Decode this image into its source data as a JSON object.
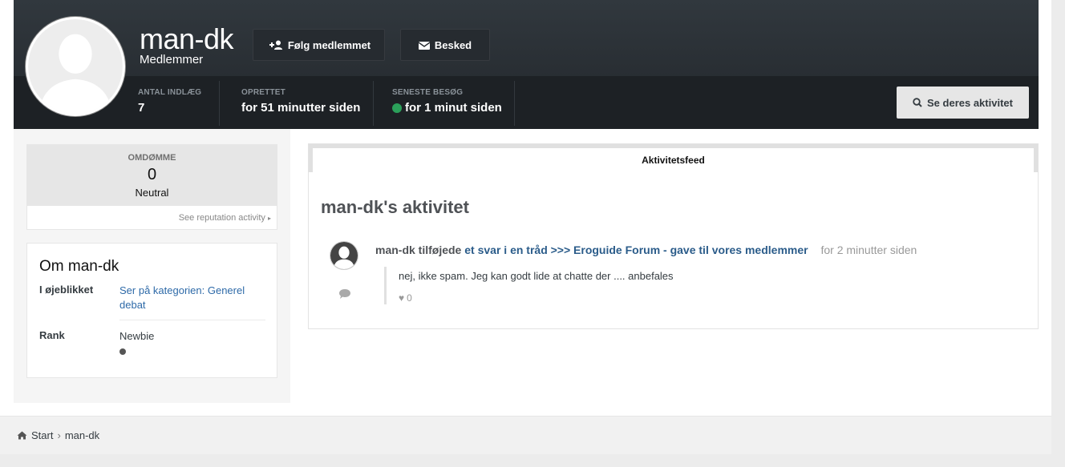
{
  "profile": {
    "username": "man-dk",
    "usergroup": "Medlemmer",
    "follow_button": "Følg medlemmet",
    "message_button": "Besked",
    "activity_button": "Se deres aktivitet",
    "stats": [
      {
        "label": "ANTAL INDLÆG",
        "value": "7"
      },
      {
        "label": "OPRETTET",
        "value": "for 51 minutter siden"
      },
      {
        "label": "SENESTE BESØG",
        "value": "for 1 minut siden",
        "online": true
      }
    ]
  },
  "sidebar": {
    "reputation": {
      "label": "OMDØMME",
      "value": "0",
      "word": "Neutral",
      "link": "See reputation activity"
    },
    "about": {
      "title": "Om man-dk",
      "rows": [
        {
          "key": "I øjeblikket",
          "value": "Ser på kategorien: Generel debat"
        },
        {
          "key": "Rank",
          "value": "Newbie"
        }
      ]
    }
  },
  "feed": {
    "tab": "Aktivitetsfeed",
    "title": "man-dk's aktivitet",
    "items": [
      {
        "who": "man-dk tilføjede",
        "what": "et svar i en tråd >>> Eroguide Forum - gave til vores medlemmer",
        "when": "for 2 minutter siden",
        "snippet": "nej, ikke spam. Jeg kan godt lide at chatte der .... anbefales",
        "likes": "0"
      }
    ]
  },
  "breadcrumb": {
    "home": "Start",
    "current": "man-dk"
  },
  "colors": {
    "header": "#262b30",
    "link": "#2b5c8a",
    "online": "#2ba05a"
  }
}
